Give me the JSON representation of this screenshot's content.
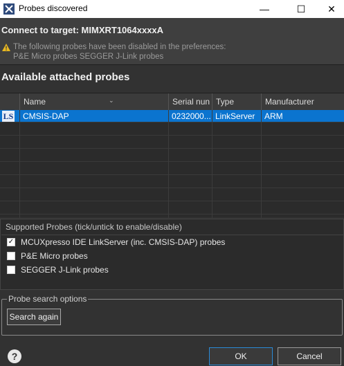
{
  "window": {
    "title": "Probes discovered",
    "app_icon": "mcuxpresso-x-icon",
    "minimize_glyph": "—",
    "maximize_glyph": "☐",
    "close_glyph": "✕"
  },
  "header": {
    "title": "Connect to target: MIMXRT1064xxxxA",
    "warning_icon": "warning-triangle-icon",
    "warning_line1": "The following probes have been disabled in the preferences:",
    "warning_line2": "P&E Micro probes SEGGER J-Link probes"
  },
  "section_title": "Available attached probes",
  "table": {
    "sort_glyph": "⌄",
    "columns": [
      "Name",
      "Serial nun",
      "Type",
      "Manufacturer"
    ],
    "rows": [
      {
        "icon": "LS",
        "name": "CMSIS-DAP",
        "serial": "0232000...",
        "type": "LinkServer",
        "manufacturer": "ARM",
        "selected": true
      }
    ]
  },
  "supported": {
    "label": "Supported Probes (tick/untick to enable/disable)",
    "probes": [
      {
        "label": "MCUXpresso IDE LinkServer (inc. CMSIS-DAP) probes",
        "checked": true,
        "check_glyph": "✓"
      },
      {
        "label": "P&E Micro probes",
        "checked": false,
        "check_glyph": ""
      },
      {
        "label": "SEGGER J-Link probes",
        "checked": false,
        "check_glyph": ""
      }
    ]
  },
  "search_options": {
    "legend": "Probe search options",
    "search_again_label": "Search again"
  },
  "footer": {
    "help_glyph": "?",
    "ok_label": "OK",
    "cancel_label": "Cancel"
  },
  "colors": {
    "background": "#323232",
    "selection": "#0b74cf",
    "ok_border": "#2a8bd8"
  }
}
